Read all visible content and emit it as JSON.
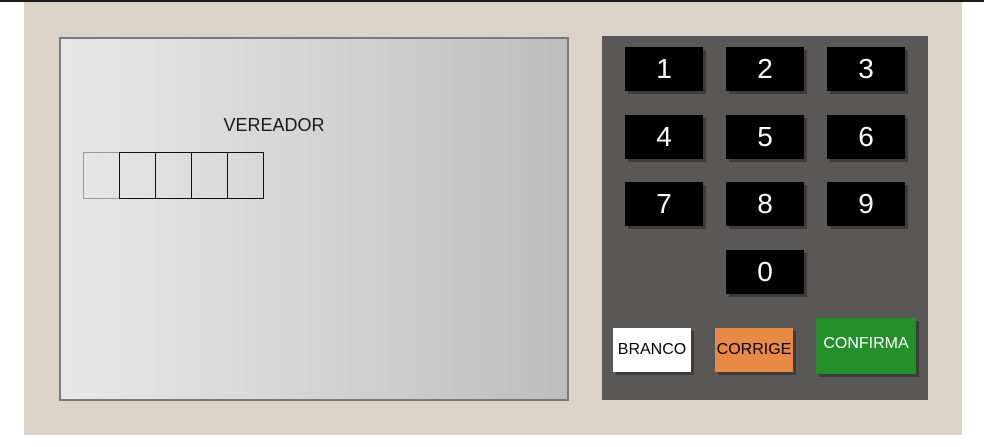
{
  "screen": {
    "office_label": "VEREADOR",
    "digits": [
      "",
      "",
      "",
      "",
      ""
    ]
  },
  "keypad": {
    "keys": [
      "1",
      "2",
      "3",
      "4",
      "5",
      "6",
      "7",
      "8",
      "9",
      "0"
    ],
    "branco_label": "BRANCO",
    "corrige_label": "CORRIGE",
    "confirma_label": "CONFIRMA"
  },
  "colors": {
    "panel_background": "#dbd3c8",
    "keypad_background": "#5a5857",
    "key_background": "#000000",
    "branco": "#ffffff",
    "corrige": "#e88a45",
    "confirma": "#23902a"
  }
}
